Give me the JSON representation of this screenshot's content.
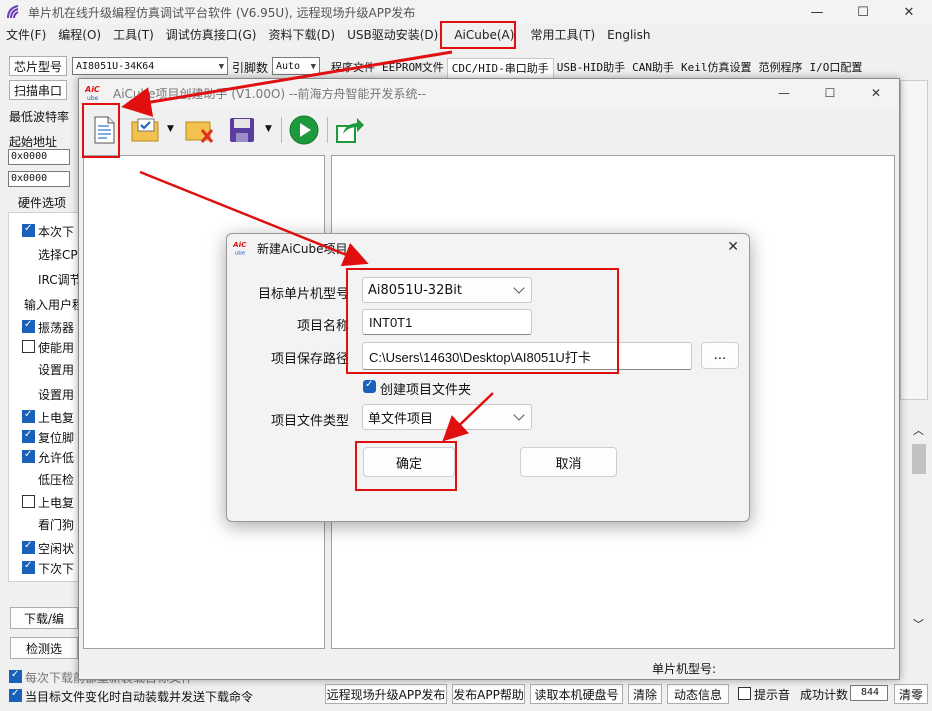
{
  "main_window": {
    "title": "单片机在线升级编程仿真调试平台软件 (V6.95U), 远程现场升级APP发布",
    "menu": [
      "文件(F)",
      "编程(O)",
      "工具(T)",
      "调试仿真接口(G)",
      "资料下载(D)",
      "USB驱动安装(D)",
      "AiCube(A)",
      "常用工具(T)",
      "English"
    ],
    "chip_label": "芯片型号",
    "chip_value": "AI8051U-34K64",
    "pin_label": "引脚数",
    "pin_value": "Auto",
    "tabs": [
      "程序文件",
      "EEPROM文件",
      "CDC/HID-串口助手",
      "USB-HID助手",
      "CAN助手",
      "Keil仿真设置",
      "范例程序",
      "I/O口配置"
    ],
    "scan_port": "扫描串口",
    "min_baud": "最低波特率",
    "start_addr": "起始地址",
    "addr1": "0x0000",
    "addr2": "0x0000",
    "hw_tab": "硬件选项",
    "hw_options": [
      {
        "label": "本次下",
        "checked": true
      },
      {
        "label": "选择CPU",
        "checked": null
      },
      {
        "label": "IRC调节",
        "checked": null
      },
      {
        "label": "输入用户程",
        "checked": null
      },
      {
        "label": "振荡器",
        "checked": true
      },
      {
        "label": "使能用",
        "checked": false
      },
      {
        "label": "设置用",
        "checked": null
      },
      {
        "label": "设置用",
        "checked": null
      },
      {
        "label": "上电复",
        "checked": true
      },
      {
        "label": "复位脚",
        "checked": true
      },
      {
        "label": "允许低",
        "checked": true
      },
      {
        "label": "低压检",
        "checked": null
      },
      {
        "label": "上电复",
        "checked": false
      },
      {
        "label": "看门狗",
        "checked": null
      },
      {
        "label": "空闲状",
        "checked": true
      },
      {
        "label": "下次下",
        "checked": true
      }
    ],
    "download_btn": "下载/编",
    "detect_btn": "检测选",
    "auto_reload": "每次下载前都重新装载目标文件",
    "auto_send": "当目标文件变化时自动装载并发送下载命令",
    "bottom_buttons": [
      "远程现场升级APP发布",
      "发布APP帮助",
      "读取本机硬盘号",
      "清除",
      "动态信息"
    ],
    "beep_label": "提示音",
    "success_label": "成功计数",
    "success_count": "844",
    "clear_label": "清零",
    "mcu_type_label": "单片机型号:"
  },
  "aicube_window": {
    "title": "AiCube项目创建助手 (V1.00O) --前海方舟智能开发系统--",
    "toolbar_icons": [
      "new-project-icon",
      "open-project-icon",
      "close-project-icon",
      "save-icon",
      "run-icon",
      "export-icon"
    ]
  },
  "new_project_dialog": {
    "logo_text": "AiCube",
    "title": "新建AiCube项目",
    "target_mcu_label": "目标单片机型号",
    "target_mcu_value": "Ai8051U-32Bit",
    "project_name_label": "项目名称",
    "project_name_value": "INT0T1",
    "save_path_label": "项目保存路径",
    "save_path_value": "C:\\Users\\14630\\Desktop\\AI8051U打卡",
    "browse_label": "...",
    "create_folder_label": "创建项目文件夹",
    "create_folder_checked": true,
    "file_type_label": "项目文件类型",
    "file_type_value": "单文件项目",
    "ok_label": "确定",
    "cancel_label": "取消"
  },
  "colors": {
    "annotation_red": "#e01010",
    "checkbox_blue": "#1a62b9",
    "run_green": "#1c9a3c"
  }
}
